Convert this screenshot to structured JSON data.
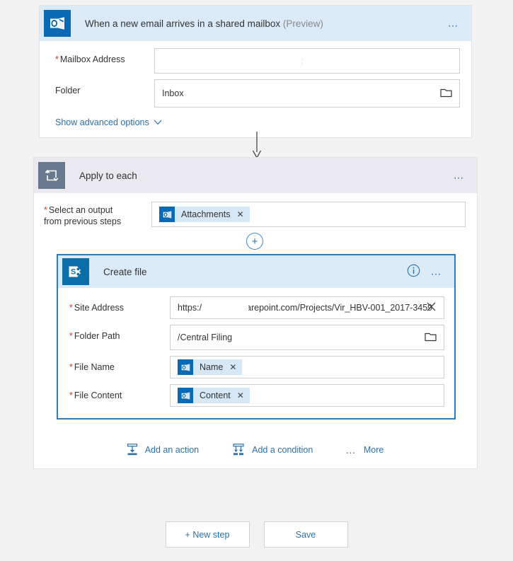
{
  "page": {
    "background_color": "#f2f2f2",
    "accent_color": "#2b6fa8",
    "selected_border_color": "#2d7bbd"
  },
  "trigger": {
    "icon": "outlook-icon",
    "title": "When a new email arrives in a shared mailbox",
    "preview_tag": "(Preview)",
    "menu_icon": "ellipsis-icon",
    "header_color": "#dbeaf7",
    "fields": [
      {
        "label": "Mailbox Address",
        "required": true,
        "value": ";",
        "redacted": true
      },
      {
        "label": "Folder",
        "required": false,
        "value": "Inbox",
        "trailing_icon": "folder-picker-icon"
      }
    ],
    "advanced_link": "Show advanced options",
    "advanced_chevron": "chevron-down-icon"
  },
  "loop": {
    "icon": "loop-icon",
    "title": "Apply to each",
    "menu_icon": "ellipsis-icon",
    "header_color": "#e9e9ef",
    "output_field": {
      "label_line1": "Select an output",
      "label_line2": "from previous steps",
      "required": true,
      "token": {
        "icon": "outlook-icon",
        "label": "Attachments",
        "remove_icon": "close-icon"
      }
    },
    "add_button_icon": "plus-icon",
    "create_file": {
      "icon": "sharepoint-icon",
      "title": "Create file",
      "info_icon": "info-icon",
      "menu_icon": "ellipsis-icon",
      "header_color": "#dbeaf7",
      "fields": [
        {
          "label": "Site Address",
          "required": true,
          "value_prefix": "https:/",
          "value_suffix": "harepoint.com/Projects/Vir_HBV-001_2017-3459",
          "redacted": true,
          "trailing_icon": "clear-icon"
        },
        {
          "label": "Folder Path",
          "required": true,
          "value": "/Central Filing",
          "trailing_icon": "folder-picker-icon"
        },
        {
          "label": "File Name",
          "required": true,
          "token": {
            "icon": "outlook-icon",
            "label": "Name",
            "remove_icon": "close-icon"
          }
        },
        {
          "label": "File Content",
          "required": true,
          "token": {
            "icon": "outlook-icon",
            "label": "Content",
            "remove_icon": "close-icon"
          }
        }
      ]
    },
    "actions": [
      {
        "label": "Add an action",
        "icon": "add-action-icon"
      },
      {
        "label": "Add a condition",
        "icon": "add-condition-icon"
      },
      {
        "label": "More",
        "icon": "ellipsis-icon"
      }
    ]
  },
  "footer": {
    "new_step_label": "+ New step",
    "save_label": "Save"
  }
}
